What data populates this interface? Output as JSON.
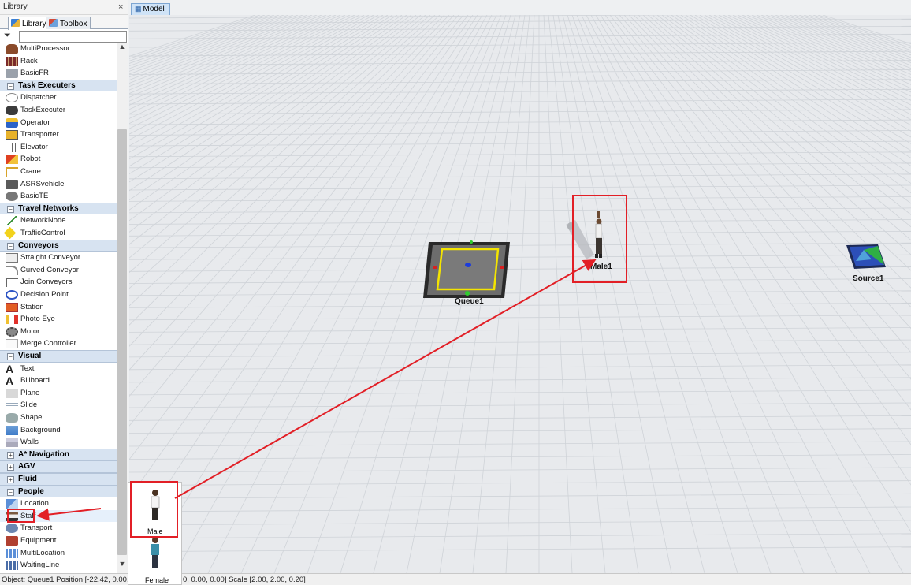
{
  "library": {
    "title": "Library",
    "close_glyph": "×",
    "tabs": [
      {
        "label": "Library",
        "icon": "library-icon"
      },
      {
        "label": "Toolbox",
        "icon": "toolbox-icon"
      }
    ],
    "filter_placeholder": "",
    "items": [
      {
        "type": "item",
        "label": "MultiProcessor",
        "icon": "multiprocessor-icon"
      },
      {
        "type": "item",
        "label": "Rack",
        "icon": "rack-icon"
      },
      {
        "type": "item",
        "label": "BasicFR",
        "icon": "basicfr-icon"
      },
      {
        "type": "category",
        "label": "Task Executers",
        "expanded": true
      },
      {
        "type": "item",
        "label": "Dispatcher",
        "icon": "dispatcher-icon"
      },
      {
        "type": "item",
        "label": "TaskExecuter",
        "icon": "taskexecuter-icon"
      },
      {
        "type": "item",
        "label": "Operator",
        "icon": "operator-icon"
      },
      {
        "type": "item",
        "label": "Transporter",
        "icon": "transporter-icon"
      },
      {
        "type": "item",
        "label": "Elevator",
        "icon": "elevator-icon"
      },
      {
        "type": "item",
        "label": "Robot",
        "icon": "robot-icon"
      },
      {
        "type": "item",
        "label": "Crane",
        "icon": "crane-icon"
      },
      {
        "type": "item",
        "label": "ASRSvehicle",
        "icon": "asrsvehicle-icon"
      },
      {
        "type": "item",
        "label": "BasicTE",
        "icon": "basicte-icon"
      },
      {
        "type": "category",
        "label": "Travel Networks",
        "expanded": true
      },
      {
        "type": "item",
        "label": "NetworkNode",
        "icon": "networknode-icon"
      },
      {
        "type": "item",
        "label": "TrafficControl",
        "icon": "trafficcontrol-icon"
      },
      {
        "type": "category",
        "label": "Conveyors",
        "expanded": true
      },
      {
        "type": "item",
        "label": "Straight Conveyor",
        "icon": "straight-conveyor-icon"
      },
      {
        "type": "item",
        "label": "Curved Conveyor",
        "icon": "curved-conveyor-icon"
      },
      {
        "type": "item",
        "label": "Join Conveyors",
        "icon": "join-conveyors-icon"
      },
      {
        "type": "item",
        "label": "Decision Point",
        "icon": "decision-point-icon"
      },
      {
        "type": "item",
        "label": "Station",
        "icon": "station-icon"
      },
      {
        "type": "item",
        "label": "Photo Eye",
        "icon": "photo-eye-icon"
      },
      {
        "type": "item",
        "label": "Motor",
        "icon": "motor-icon"
      },
      {
        "type": "item",
        "label": "Merge Controller",
        "icon": "merge-controller-icon"
      },
      {
        "type": "category",
        "label": "Visual",
        "expanded": true
      },
      {
        "type": "item",
        "label": "Text",
        "icon": "text-icon"
      },
      {
        "type": "item",
        "label": "Billboard",
        "icon": "billboard-icon"
      },
      {
        "type": "item",
        "label": "Plane",
        "icon": "plane-icon"
      },
      {
        "type": "item",
        "label": "Slide",
        "icon": "slide-icon"
      },
      {
        "type": "item",
        "label": "Shape",
        "icon": "shape-icon"
      },
      {
        "type": "item",
        "label": "Background",
        "icon": "background-icon"
      },
      {
        "type": "item",
        "label": "Walls",
        "icon": "walls-icon"
      },
      {
        "type": "category",
        "label": "A* Navigation",
        "expanded": false
      },
      {
        "type": "category",
        "label": "AGV",
        "expanded": false
      },
      {
        "type": "category",
        "label": "Fluid",
        "expanded": false
      },
      {
        "type": "category",
        "label": "People",
        "expanded": true
      },
      {
        "type": "item",
        "label": "Location",
        "icon": "location-icon"
      },
      {
        "type": "item",
        "label": "Staff",
        "icon": "staff-icon",
        "selected": true
      },
      {
        "type": "item",
        "label": "Transport",
        "icon": "transport-icon"
      },
      {
        "type": "item",
        "label": "Equipment",
        "icon": "equipment-icon"
      },
      {
        "type": "item",
        "label": "MultiLocation",
        "icon": "multilocation-icon"
      },
      {
        "type": "item",
        "label": "WaitingLine",
        "icon": "waitingline-icon"
      }
    ]
  },
  "model_tab": {
    "label": "Model"
  },
  "model": {
    "objects": [
      {
        "name": "Queue1"
      },
      {
        "name": "Male1"
      },
      {
        "name": "Source1"
      }
    ]
  },
  "staff_flyout": {
    "options": [
      {
        "label": "Male"
      },
      {
        "label": "Female"
      }
    ]
  },
  "status_bar": {
    "left": "Object: Queue1 Position [-22.42, 0.00, 0",
    "right": "0, 0.00, 0.00]  Scale [2.00, 2.00, 0.20]"
  },
  "colors": {
    "highlight_red": "#e21f26",
    "category_bg": "#d7e3f1",
    "queue_outline": "#f4e400",
    "source_blue": "#2c4fb8",
    "source_green": "#2fae45"
  }
}
